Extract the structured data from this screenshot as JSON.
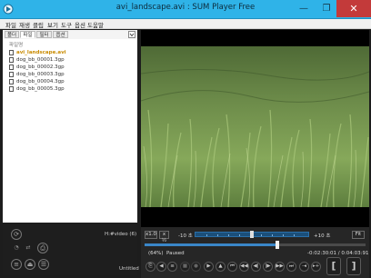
{
  "window": {
    "title": "avi_landscape.avi : SUM Player Free",
    "controls": {
      "minimize": "—",
      "maximize": "❐",
      "close": "✕"
    }
  },
  "menu": [
    "파일",
    "재생",
    "클립",
    "보기",
    "도구",
    "옵션",
    "도움말"
  ],
  "tabs": [
    "폴더",
    "파일",
    "필터",
    "옵션"
  ],
  "playlist": {
    "header": "파일명",
    "items": [
      "avi_landscape.avi",
      "dog_bb_00001.3gp",
      "dog_bb_00002.3gp",
      "dog_bb_00003.3gp",
      "dog_bb_00004.3gp",
      "dog_bb_00005.3gp"
    ]
  },
  "left_bottom": {
    "track_info": "H:#video (6)",
    "title": "Untitled"
  },
  "controls": {
    "speed": "x1.0",
    "speed_step": "x ½",
    "seek_back": "-10 초",
    "seek_fwd": "+10 초",
    "fit": "Fit",
    "volume_pct": "(64%)",
    "status": "Paused",
    "time": "-0:02:30:01 / 0:04:03:91",
    "position_pct": 60,
    "jump_position_pct": 50
  },
  "colors": {
    "titlebar": "#2fb3e8",
    "accent": "#3a86c8",
    "active_item": "#c98b00"
  }
}
